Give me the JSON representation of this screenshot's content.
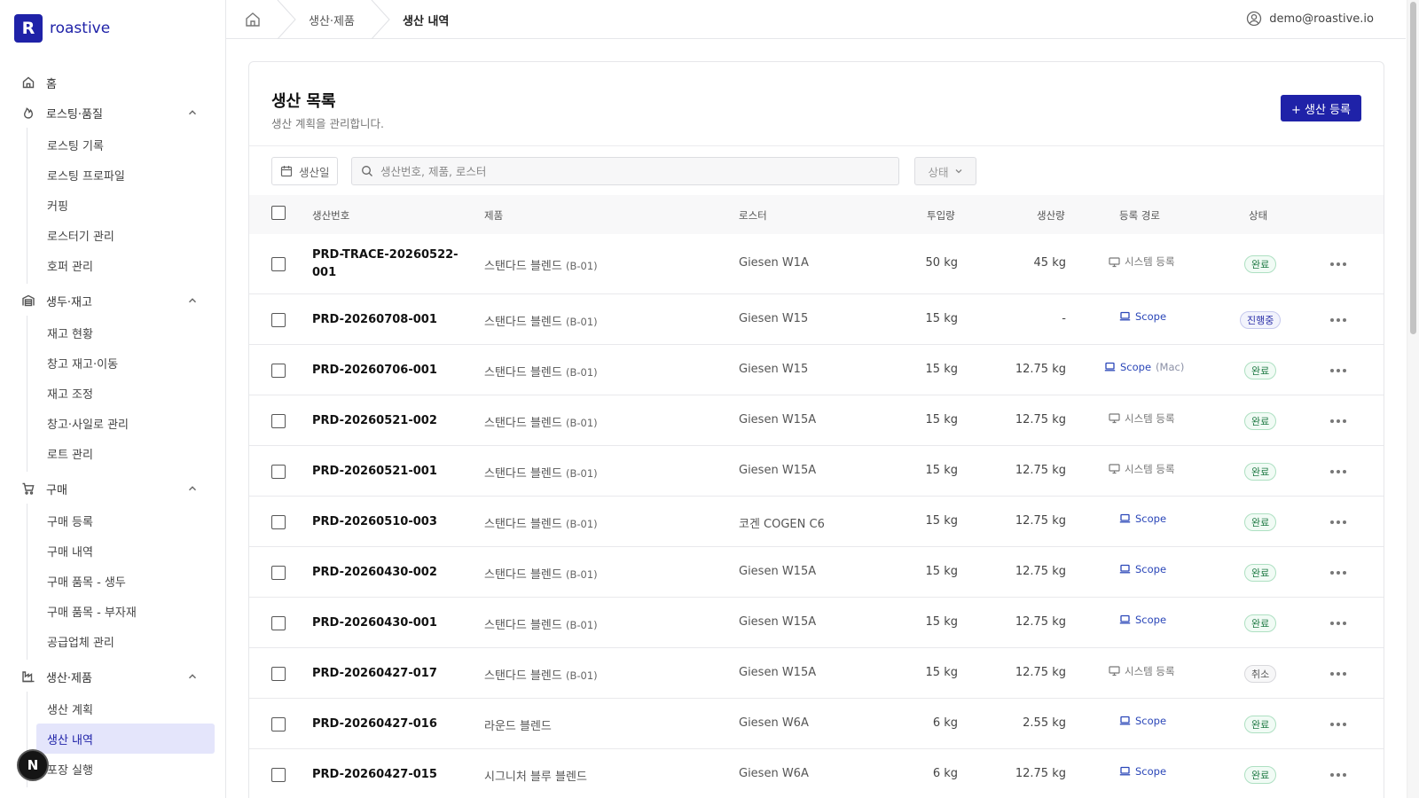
{
  "brand": {
    "logo_letter": "R",
    "name": "roastive"
  },
  "sidebar": {
    "home": "홈",
    "groups": [
      {
        "label": "로스팅·품질",
        "icon": "flame-icon",
        "items": [
          "로스팅 기록",
          "로스팅 프로파일",
          "커핑",
          "로스터기 관리",
          "호퍼 관리"
        ]
      },
      {
        "label": "생두·재고",
        "icon": "warehouse-icon",
        "items": [
          "재고 현황",
          "창고 재고·이동",
          "재고 조정",
          "창고·사일로 관리",
          "로트 관리"
        ]
      },
      {
        "label": "구매",
        "icon": "cart-icon",
        "items": [
          "구매 등록",
          "구매 내역",
          "구매 품목 - 생두",
          "구매 품목 - 부자재",
          "공급업체 관리"
        ]
      },
      {
        "label": "생산·제품",
        "icon": "factory-icon",
        "items": [
          "생산 계획",
          "생산 내역",
          "포장 실행"
        ]
      }
    ],
    "active_item": "생산 내역",
    "n_badge": "N"
  },
  "topbar": {
    "breadcrumb": [
      "생산·제품",
      "생산 내역"
    ],
    "user_email": "demo@roastive.io"
  },
  "page": {
    "title": "생산 목록",
    "subtitle": "생산 계획을 관리합니다.",
    "add_button": "+ 생산 등록",
    "filters": {
      "date_label": "생산일",
      "search_placeholder": "생산번호, 제품, 로스터",
      "status_label": "상태"
    }
  },
  "table": {
    "columns": [
      "생산번호",
      "제품",
      "로스터",
      "투입량",
      "생산량",
      "등록 경로",
      "상태"
    ],
    "rows": [
      {
        "id": "PRD-TRACE-20260522-001",
        "product": "스탠다드 블렌드",
        "code": "(B-01)",
        "roaster": "Giesen W1A",
        "input": "50 kg",
        "output": "45 kg",
        "route": "시스템 등록",
        "route_type": "system",
        "route_extra": "",
        "status": "완료",
        "status_type": "done"
      },
      {
        "id": "PRD-20260708-001",
        "product": "스탠다드 블렌드",
        "code": "(B-01)",
        "roaster": "Giesen W15",
        "input": "15 kg",
        "output": "-",
        "route": "Scope",
        "route_type": "scope",
        "route_extra": "",
        "status": "진행중",
        "status_type": "prog"
      },
      {
        "id": "PRD-20260706-001",
        "product": "스탠다드 블렌드",
        "code": "(B-01)",
        "roaster": "Giesen W15",
        "input": "15 kg",
        "output": "12.75 kg",
        "route": "Scope",
        "route_type": "scope",
        "route_extra": "(Mac)",
        "status": "완료",
        "status_type": "done"
      },
      {
        "id": "PRD-20260521-002",
        "product": "스탠다드 블렌드",
        "code": "(B-01)",
        "roaster": "Giesen W15A",
        "input": "15 kg",
        "output": "12.75 kg",
        "route": "시스템 등록",
        "route_type": "system",
        "route_extra": "",
        "status": "완료",
        "status_type": "done"
      },
      {
        "id": "PRD-20260521-001",
        "product": "스탠다드 블렌드",
        "code": "(B-01)",
        "roaster": "Giesen W15A",
        "input": "15 kg",
        "output": "12.75 kg",
        "route": "시스템 등록",
        "route_type": "system",
        "route_extra": "",
        "status": "완료",
        "status_type": "done"
      },
      {
        "id": "PRD-20260510-003",
        "product": "스탠다드 블렌드",
        "code": "(B-01)",
        "roaster": "코겐 COGEN C6",
        "input": "15 kg",
        "output": "12.75 kg",
        "route": "Scope",
        "route_type": "scope",
        "route_extra": "",
        "status": "완료",
        "status_type": "done"
      },
      {
        "id": "PRD-20260430-002",
        "product": "스탠다드 블렌드",
        "code": "(B-01)",
        "roaster": "Giesen W15A",
        "input": "15 kg",
        "output": "12.75 kg",
        "route": "Scope",
        "route_type": "scope",
        "route_extra": "",
        "status": "완료",
        "status_type": "done"
      },
      {
        "id": "PRD-20260430-001",
        "product": "스탠다드 블렌드",
        "code": "(B-01)",
        "roaster": "Giesen W15A",
        "input": "15 kg",
        "output": "12.75 kg",
        "route": "Scope",
        "route_type": "scope",
        "route_extra": "",
        "status": "완료",
        "status_type": "done"
      },
      {
        "id": "PRD-20260427-017",
        "product": "스탠다드 블렌드",
        "code": "(B-01)",
        "roaster": "Giesen W15A",
        "input": "15 kg",
        "output": "12.75 kg",
        "route": "시스템 등록",
        "route_type": "system",
        "route_extra": "",
        "status": "취소",
        "status_type": "cancel"
      },
      {
        "id": "PRD-20260427-016",
        "product": "라운드 블렌드",
        "code": "",
        "roaster": "Giesen W6A",
        "input": "6 kg",
        "output": "2.55 kg",
        "route": "Scope",
        "route_type": "scope",
        "route_extra": "",
        "status": "완료",
        "status_type": "done"
      },
      {
        "id": "PRD-20260427-015",
        "product": "시그니처 블루 블렌드",
        "code": "",
        "roaster": "Giesen W6A",
        "input": "6 kg",
        "output": "12.75 kg",
        "route": "Scope",
        "route_type": "scope",
        "route_extra": "",
        "status": "완료",
        "status_type": "done"
      }
    ]
  }
}
